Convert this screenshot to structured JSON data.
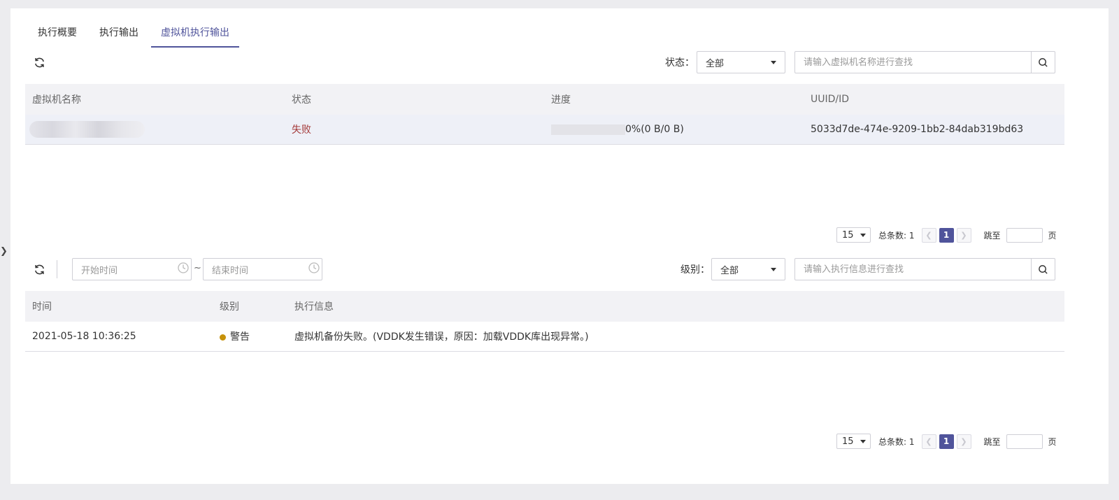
{
  "tabs": [
    {
      "label": "执行概要"
    },
    {
      "label": "执行输出"
    },
    {
      "label": "虚拟机执行输出"
    }
  ],
  "vm_section": {
    "status_label": "状态：",
    "status_value": "全部",
    "search_placeholder": "请输入虚拟机名称进行查找",
    "columns": [
      "虚拟机名称",
      "状态",
      "进度",
      "UUID/ID"
    ],
    "rows": [
      {
        "name": "",
        "status": "失败",
        "progress_percent": 0,
        "progress_text": "0%(0 B/0 B)",
        "uuid": "5033d7de-474e-9209-1bb2-84dab319bd63"
      }
    ],
    "pager": {
      "page_size": "15",
      "total": "总条数: 1",
      "current_page": "1",
      "jump_label": "跳至",
      "page_suffix": "页"
    }
  },
  "log_section": {
    "start_placeholder": "开始时间",
    "end_placeholder": "结束时间",
    "range_sep": "~",
    "level_label": "级别：",
    "level_value": "全部",
    "search_placeholder": "请输入执行信息进行查找",
    "columns": [
      "时间",
      "级别",
      "执行信息"
    ],
    "rows": [
      {
        "time": "2021-05-18 10:36:25",
        "level": "警告",
        "level_color": "#c7920a",
        "message": "虚拟机备份失败。(VDDK发生错误，原因：加载VDDK库出现异常。)"
      }
    ],
    "pager": {
      "page_size": "15",
      "total": "总条数: 1",
      "current_page": "1",
      "jump_label": "跳至",
      "page_suffix": "页"
    }
  },
  "colors": {
    "accent": "#50549b",
    "fail": "#a43a3a",
    "warning": "#c7920a"
  },
  "icons": [
    "refresh-icon",
    "search-icon",
    "clock-icon",
    "chevron-down-icon",
    "chevron-left-icon",
    "chevron-right-icon"
  ]
}
